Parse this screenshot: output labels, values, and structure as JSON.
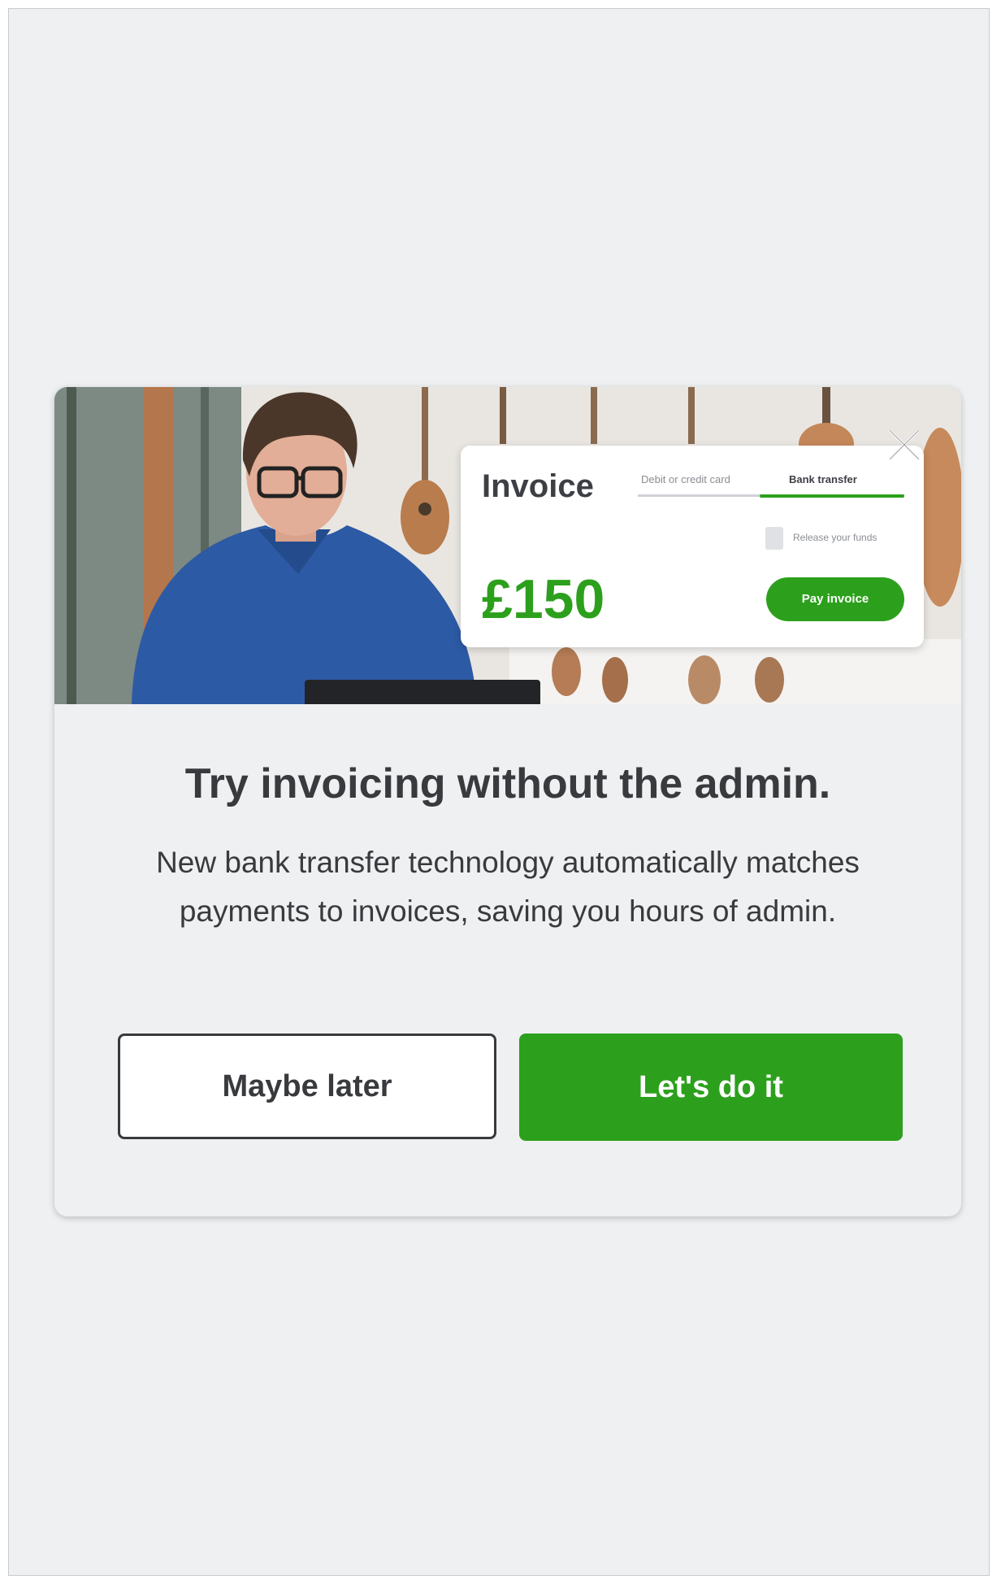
{
  "modal": {
    "close_icon": "close-icon",
    "headline": "Try invoicing without the admin.",
    "body": "New bank transfer technology automatically matches payments to invoices, saving you hours of admin.",
    "secondary_button_label": "Maybe later",
    "primary_button_label": "Let's do it"
  },
  "invoice_card": {
    "title": "Invoice",
    "tabs": [
      "Debit or credit card",
      "Bank transfer"
    ],
    "active_tab": "Bank transfer",
    "release_text": "Release your funds",
    "amount": "£150",
    "pay_button_label": "Pay invoice"
  },
  "colors": {
    "accent_green": "#2ca01c",
    "text_dark": "#393a3d",
    "background": "#eff0f2"
  }
}
